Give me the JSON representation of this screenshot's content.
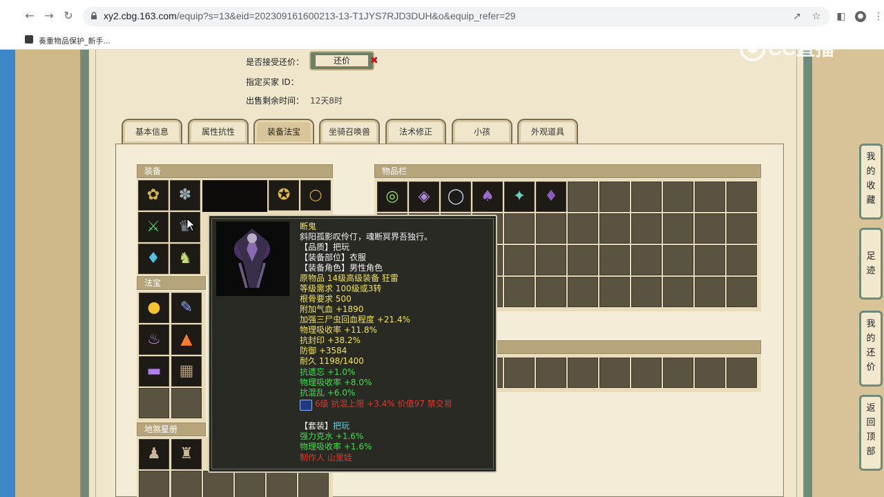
{
  "browser": {
    "url_host": "xy2.cbg.163.com",
    "url_path": "/equip?s=13&eid=202309161600213-13-T1JYS7RJD3DUH&o&equip_refer=29",
    "bookmark_label": "奏重物品保护_新手..."
  },
  "watermark": {
    "text": "CC直播"
  },
  "info": {
    "accept_counter_label": "是否接受还价：",
    "counter_button": "还价",
    "buyer_id_label": "指定买家 ID：",
    "remaining_label": "出售剩余时间：",
    "remaining_value": "12天8时"
  },
  "tabs": [
    {
      "label": "基本信息"
    },
    {
      "label": "属性抗性"
    },
    {
      "label": "装备法宝"
    },
    {
      "label": "坐骑召唤兽"
    },
    {
      "label": "法术修正"
    },
    {
      "label": "小孩"
    },
    {
      "label": "外观道具"
    }
  ],
  "sections": {
    "equipment": "装备",
    "inventory": "物品栏",
    "treasure": "法宝",
    "star_book": "地煞星册"
  },
  "tooltip": {
    "name": "断鬼",
    "desc": "斜阳孤影叹伶仃，魂断冥界吾独行。",
    "quality": "【品质】把玩",
    "slot": "【装备部位】衣服",
    "role": "【装备角色】男性角色",
    "origin": "原物品 14级高级装备 狂雷",
    "level_req": "等级需求 100级或3转",
    "bone_req": "根骨要求 500",
    "hp": "附加气血 +1890",
    "three_corpse": "加强三尸虫回血程度 +21.4%",
    "phys_absorb": "物理吸收率 +11.8%",
    "anti_seal": "抗封印 +38.2%",
    "defense": "防御 +3584",
    "durability": "耐久 1198/1400",
    "anti_forget": "抗遗忘 +1.0%",
    "phys_absorb2": "物理吸收率 +8.0%",
    "anti_chaos": "抗混乱 +6.0%",
    "gem_line": "6级 抗混上限 +3.4% 价值97 禁交易",
    "set_label": "【套装】",
    "set_name": "把玩",
    "set_water": "强力克水 +1.6%",
    "set_phys": "物理吸收率 +1.6%",
    "maker": "制作人 山里娃"
  },
  "side_nav": [
    {
      "label": "我的收藏",
      "chars": [
        "我",
        "的",
        "收",
        "藏"
      ]
    },
    {
      "label": "足迹",
      "chars": [
        "足",
        "迹"
      ]
    },
    {
      "label": "我的还价",
      "chars": [
        "我",
        "的",
        "还",
        "价"
      ]
    },
    {
      "label": "返回顶部",
      "chars": [
        "返",
        "回",
        "顶",
        "部"
      ]
    }
  ],
  "colors": {
    "tooltip_bg": "#2a2a24",
    "yellow_text": "#f2e35a",
    "green_text": "#39e04a",
    "red_text": "#e2362a",
    "frame_green": "#6f8a7a"
  },
  "icons": {
    "back": "arrow-left-icon",
    "forward": "arrow-right-icon",
    "reload": "reload-icon",
    "lock": "lock-icon",
    "share": "share-icon",
    "star": "star-icon",
    "sidebar": "sidebar-icon",
    "profile": "profile-icon",
    "menu": "more-vert-icon"
  }
}
